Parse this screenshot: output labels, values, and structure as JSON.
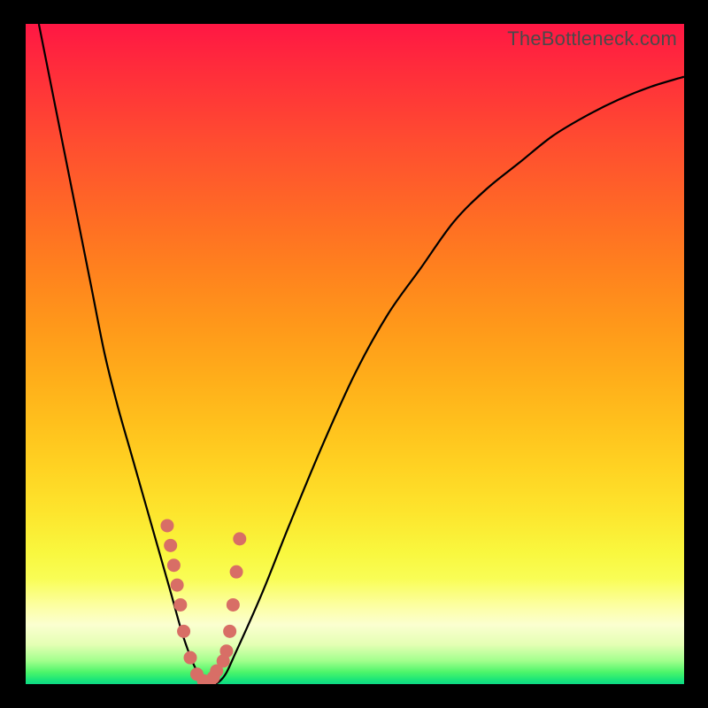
{
  "watermark": "TheBottleneck.com",
  "colors": {
    "frame": "#000000",
    "gradient_top": "#ff1744",
    "gradient_mid": "#ffd222",
    "gradient_bottom": "#0cd985",
    "curve": "#000000",
    "marker": "#d86e66"
  },
  "chart_data": {
    "type": "line",
    "title": "",
    "xlabel": "",
    "ylabel": "",
    "xlim": [
      0,
      100
    ],
    "ylim": [
      0,
      100
    ],
    "series": [
      {
        "name": "bottleneck-curve",
        "x": [
          2,
          4,
          6,
          8,
          10,
          12,
          14,
          16,
          18,
          20,
          22,
          24,
          26,
          28,
          30,
          32,
          36,
          40,
          45,
          50,
          55,
          60,
          65,
          70,
          75,
          80,
          85,
          90,
          95,
          100
        ],
        "values": [
          100,
          90,
          80,
          70,
          60,
          50,
          42,
          35,
          28,
          21,
          14,
          7,
          2,
          0,
          1,
          5,
          14,
          24,
          36,
          47,
          56,
          63,
          70,
          75,
          79,
          83,
          86,
          88.5,
          90.5,
          92
        ]
      }
    ],
    "markers": {
      "name": "highlighted-points",
      "x": [
        21.5,
        22,
        22.5,
        23,
        23.5,
        24,
        25,
        26,
        27,
        28,
        28.5,
        29,
        30,
        30.5,
        31,
        31.5,
        32,
        32.5
      ],
      "values": [
        24,
        21,
        18,
        15,
        12,
        8,
        4,
        1.5,
        0.5,
        0.5,
        1,
        2,
        3.5,
        5,
        8,
        12,
        17,
        22
      ]
    }
  }
}
